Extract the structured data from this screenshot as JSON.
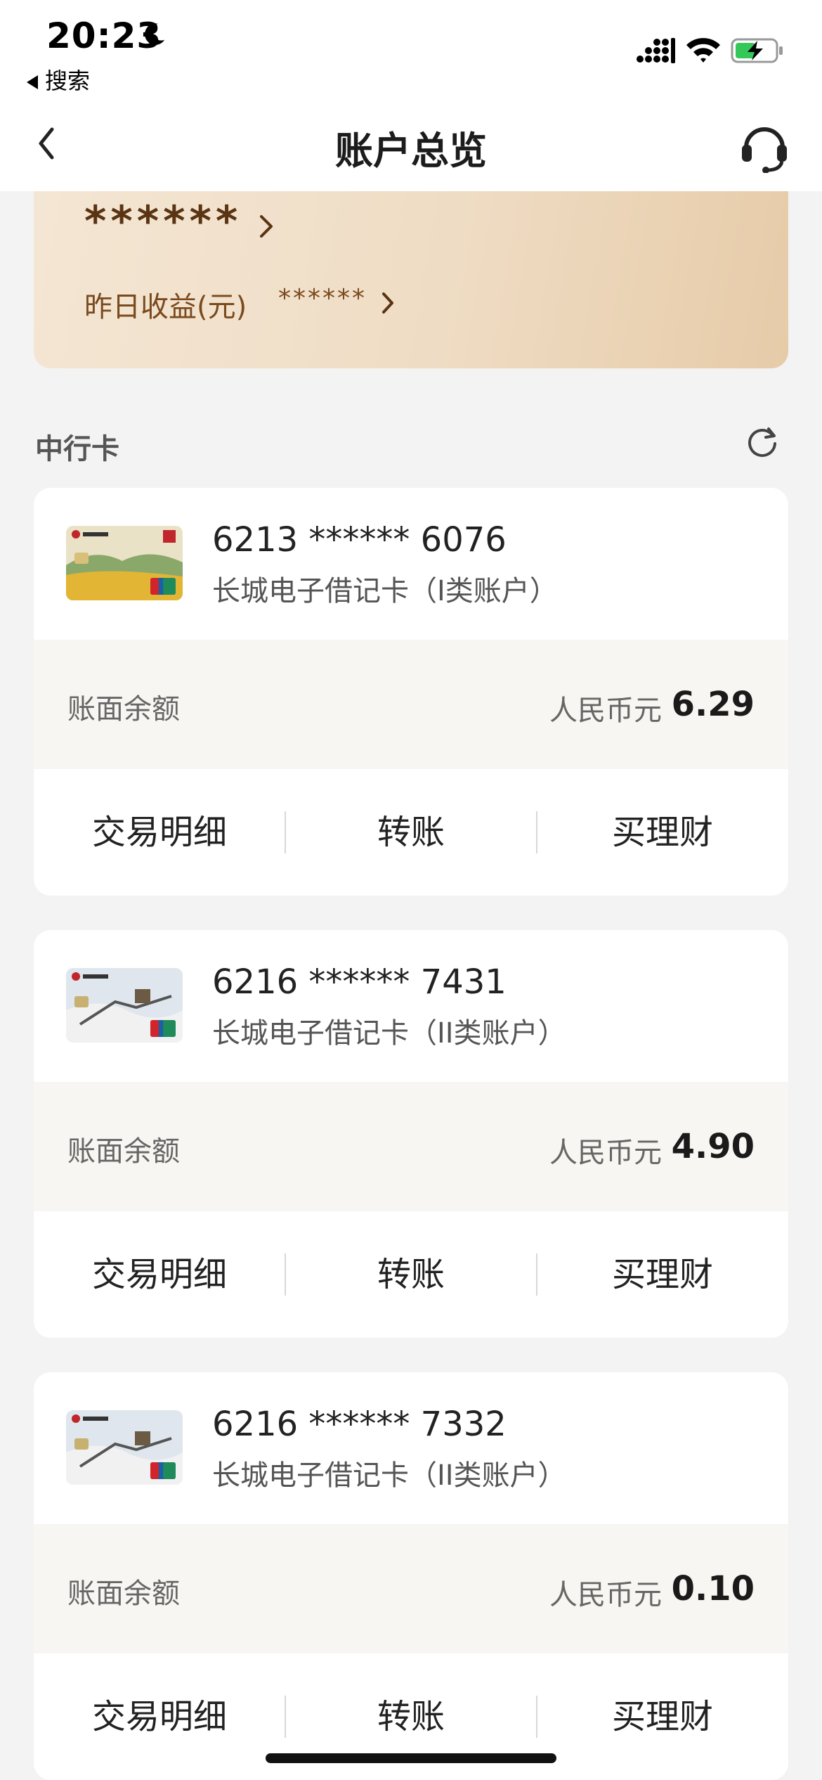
{
  "status_bar": {
    "time": "20:23",
    "back_app": "搜索"
  },
  "nav": {
    "title": "账户总览"
  },
  "summary": {
    "masked_total": "******",
    "yesterday_label": "昨日收益(元)",
    "yesterday_value": "******"
  },
  "section": {
    "title": "中行卡"
  },
  "cards": [
    {
      "number": "6213 ****** 6076",
      "type": "长城电子借记卡（I类账户）",
      "balance_label": "账面余额",
      "currency": "人民币元",
      "balance": "6.29",
      "actions": [
        "交易明细",
        "转账",
        "买理财"
      ]
    },
    {
      "number": "6216 ****** 7431",
      "type": "长城电子借记卡（II类账户）",
      "balance_label": "账面余额",
      "currency": "人民币元",
      "balance": "4.90",
      "actions": [
        "交易明细",
        "转账",
        "买理财"
      ]
    },
    {
      "number": "6216 ****** 7332",
      "type": "长城电子借记卡（II类账户）",
      "balance_label": "账面余额",
      "currency": "人民币元",
      "balance": "0.10",
      "actions": [
        "交易明细",
        "转账",
        "买理财"
      ]
    }
  ],
  "icons": {
    "moon": "moon-icon",
    "signal": "signal-icon",
    "wifi": "wifi-icon",
    "battery": "battery-charging-icon",
    "back": "chevron-left-icon",
    "service": "headset-icon",
    "refresh": "refresh-icon"
  },
  "colors": {
    "summary_gold": "#efdcc4",
    "summary_text": "#7a4a1e",
    "balance_band": "#f8f6f2"
  }
}
